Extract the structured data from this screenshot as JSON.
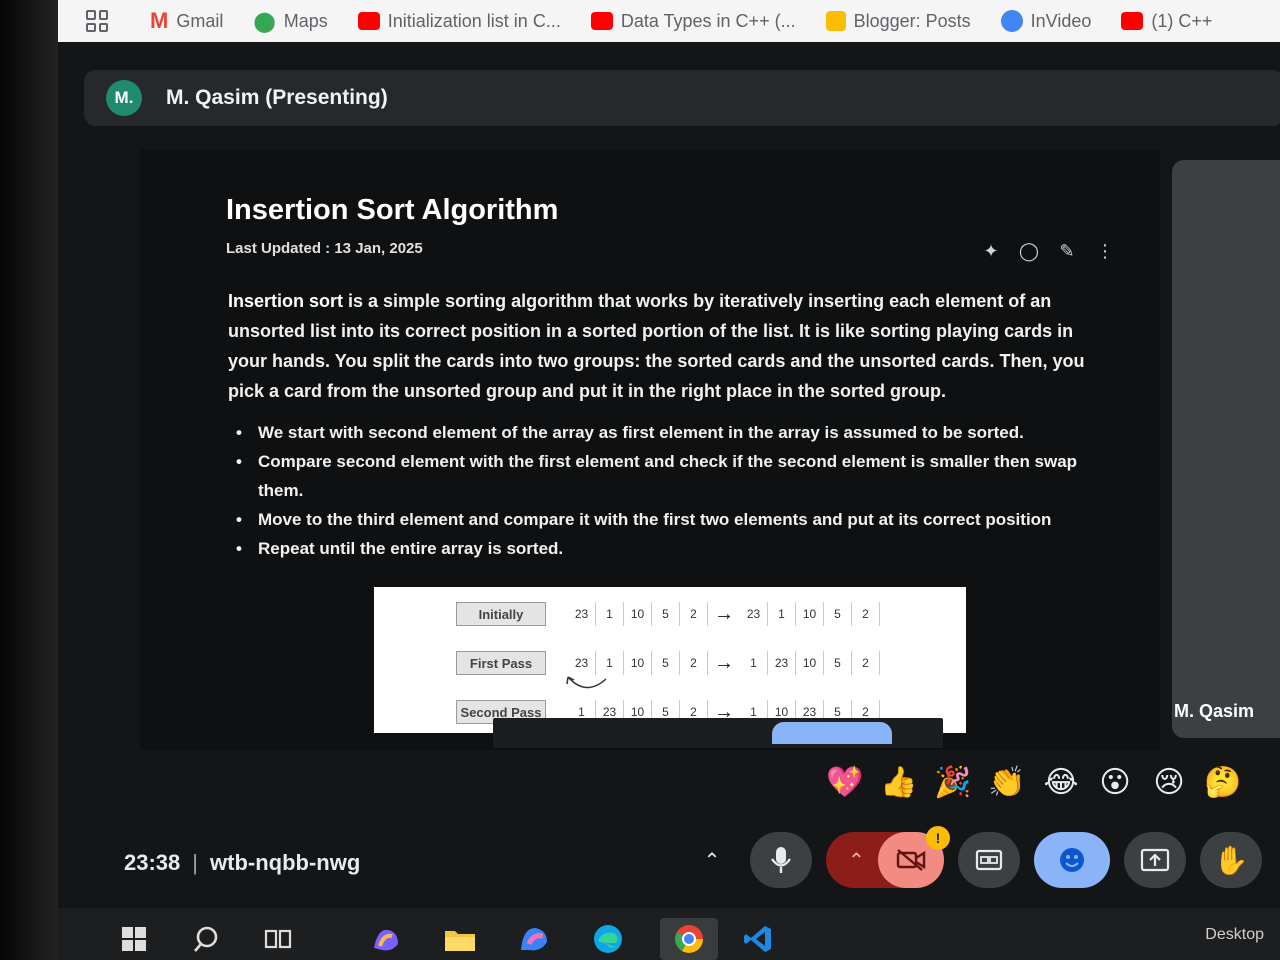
{
  "bookmarks": [
    {
      "label": "Gmail",
      "color": "#ea4335"
    },
    {
      "label": "Maps",
      "color": "#34a853"
    },
    {
      "label": "Initialization list in C...",
      "color": "#ff0000"
    },
    {
      "label": "Data Types in C++ (...",
      "color": "#ff0000"
    },
    {
      "label": "Blogger: Posts",
      "color": "#fbbc04"
    },
    {
      "label": "InVideo",
      "color": "#4285f4"
    },
    {
      "label": "(1) C++",
      "color": "#ff0000"
    }
  ],
  "presenter": {
    "avatar_initial": "M.",
    "name": "M. Qasim (Presenting)"
  },
  "article": {
    "title": "Insertion Sort Algorithm",
    "last_updated": "Last Updated : 13 Jan, 2025",
    "intro_bold": "Insertion sort",
    "intro_rest": " is a simple sorting algorithm that works by iteratively inserting each element of an unsorted list into its correct position in a sorted portion of the list. It is like sorting playing cards in your hands. You split the cards into two groups: the sorted cards and the unsorted cards. Then, you pick a card from the unsorted group and put it in the right place in the sorted group.",
    "bullets": [
      "We start with second element of the array as first element in the array is assumed to be sorted.",
      "Compare second element with the first element and check if the second element is smaller then swap them.",
      "Move to the third element and compare it with the first two elements and put at its correct position",
      "Repeat until the entire array is sorted."
    ]
  },
  "diagram": {
    "rows": [
      {
        "label": "Initially",
        "before": [
          "23",
          "1",
          "10",
          "5",
          "2"
        ],
        "after": [
          "23",
          "1",
          "10",
          "5",
          "2"
        ]
      },
      {
        "label": "First Pass",
        "before": [
          "23",
          "1",
          "10",
          "5",
          "2"
        ],
        "after": [
          "1",
          "23",
          "10",
          "5",
          "2"
        ]
      },
      {
        "label": "Second Pass",
        "before": [
          "1",
          "23",
          "10",
          "5",
          "2"
        ],
        "after": [
          "1",
          "10",
          "23",
          "5",
          "2"
        ]
      }
    ],
    "arrow": "→"
  },
  "self_tile": {
    "name": "M. Qasim"
  },
  "reactions": [
    "💖",
    "👍",
    "🎉",
    "👏",
    "😂",
    "😮",
    "😢",
    "🤔"
  ],
  "meeting": {
    "time": "23:38",
    "separator": "|",
    "code": "wtb-nqbb-nwg"
  },
  "controls": {
    "camera_badge": "!"
  },
  "taskbar": {
    "desktop_label": "Desktop"
  }
}
